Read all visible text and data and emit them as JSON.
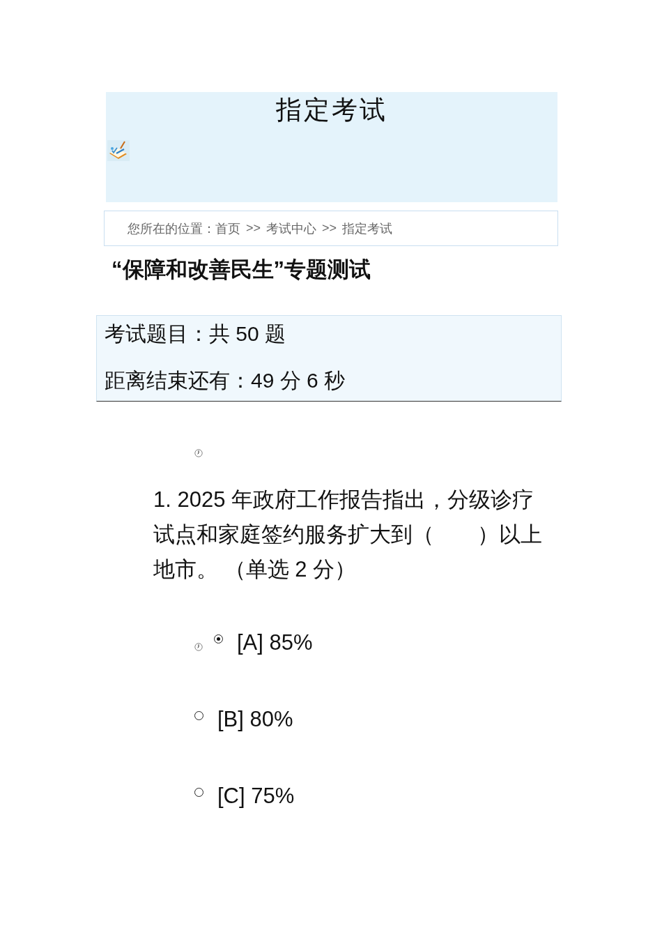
{
  "header": {
    "title": "指定考试"
  },
  "breadcrumb": {
    "prefix": "您所在的位置：",
    "crumbs": [
      {
        "kind": "link",
        "text": "首页"
      },
      {
        "kind": "separator",
        "text": ">>"
      },
      {
        "kind": "link",
        "text": "考试中心"
      },
      {
        "kind": "separator",
        "text": ">>"
      },
      {
        "kind": "link",
        "text": "指定考试"
      }
    ]
  },
  "exam_title": "“保障和改善民生”专题测试",
  "exam_info": {
    "question_count": "考试题目：共 50 题",
    "time_left": "距离结束还有：49 分 6 秒"
  },
  "question": {
    "text": "1. 2025 年政府工作报告指出，分级诊疗试点和家庭签约服务扩大到（　　）以上地市。 （单选 2 分）",
    "options": [
      {
        "label": "[A] 85%",
        "selected": true
      },
      {
        "label": "[B] 80%",
        "selected": false
      },
      {
        "label": "[C] 75%",
        "selected": false
      }
    ]
  }
}
